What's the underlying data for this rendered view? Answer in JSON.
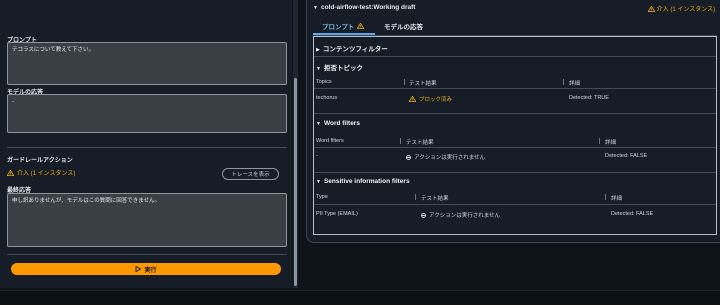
{
  "left": {
    "prompt_label": "プロンプト",
    "prompt_value": "テコラスについて教えて下さい。",
    "response_label": "モデルの応答",
    "response_value": "-",
    "guardrail_label": "ガードレールアクション",
    "guardrail_status": "介入 (1 インスタンス)",
    "trace_button": "トレースを表示",
    "final_label": "最終応答",
    "final_value": "申し訳ありませんが、モデルはこの質問に回答できません。",
    "run_button": "実行"
  },
  "right": {
    "title": "cold-airflow-test:Working draft",
    "status": "介入 (1 インスタンス)",
    "tabs": [
      {
        "label": "プロンプト"
      },
      {
        "label": "モデルの応答"
      }
    ],
    "content_filter": {
      "title": "コンテンツフィルター"
    },
    "denied_topics": {
      "title": "拒否トピック",
      "headers": [
        "Topics",
        "テスト結果",
        "詳細"
      ],
      "rows": [
        {
          "name": "techorus",
          "result": "ブロック済み",
          "detail": "Detected: TRUE"
        }
      ]
    },
    "word_filters": {
      "title": "Word filters",
      "headers": [
        "Word filters",
        "テスト結果",
        "詳細"
      ],
      "rows": [
        {
          "name": "-",
          "result": "アクションは実行されません",
          "detail": "Detected: FALSE"
        }
      ]
    },
    "sensitive_info": {
      "title": "Sensitive information filters",
      "headers": [
        "Type",
        "テスト結果",
        "詳細"
      ],
      "rows": [
        {
          "name": "PII Type (EMAIL)",
          "result": "アクションは実行されません",
          "detail": "Detected: FALSE"
        }
      ]
    }
  },
  "colors": {
    "accent": "#ff9900",
    "warning": "#f2b00f",
    "tab_active": "#7ab7f0",
    "background": "#0f141a",
    "panel": "#161d26"
  }
}
